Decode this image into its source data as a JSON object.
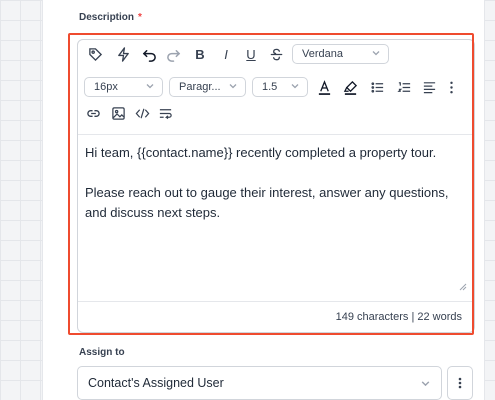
{
  "description": {
    "label": "Description",
    "required_marker": "*",
    "toolbar": {
      "font_family": "Verdana",
      "font_size": "16px",
      "block_format": "Paragr...",
      "line_height": "1.5"
    },
    "body": [
      "Hi team, {{contact.name}} recently completed a property tour.",
      "Please reach out to gauge their interest, answer any questions, and discuss next steps."
    ],
    "counter": "149 characters | 22 words"
  },
  "assign_to": {
    "label": "Assign to",
    "value": "Contact's Assigned User"
  },
  "colors": {
    "highlight": "#ef4b2f",
    "required": "#ef4444"
  }
}
